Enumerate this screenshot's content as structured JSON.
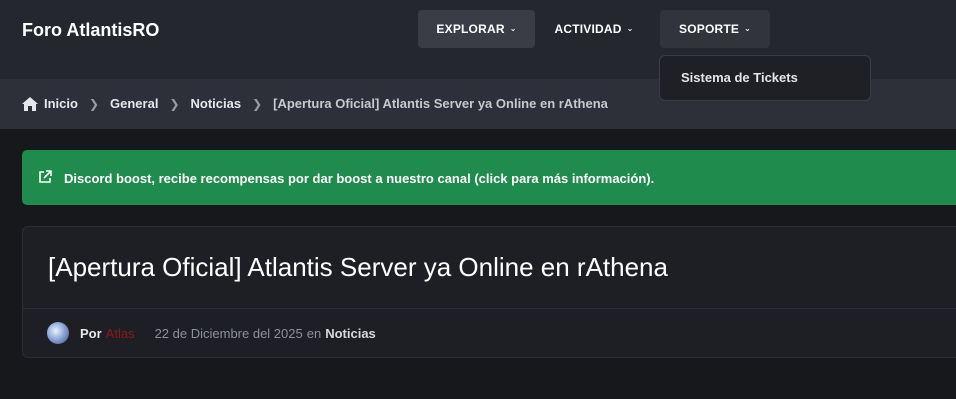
{
  "header": {
    "site_title": "Foro AtlantisRO",
    "nav": [
      {
        "label": "EXPLORAR"
      },
      {
        "label": "ACTIVIDAD"
      },
      {
        "label": "SOPORTE"
      }
    ],
    "dropdown": {
      "items": [
        {
          "label": "Sistema de Tickets"
        }
      ]
    }
  },
  "breadcrumb": {
    "items": [
      "Inicio",
      "General",
      "Noticias",
      "[Apertura Oficial] Atlantis Server ya Online en rAthena"
    ]
  },
  "alert": {
    "text": "Discord boost, recibe recompensas por dar boost a nuestro canal (click para más información).",
    "icon": "external-link-icon",
    "color": "#1f8b4c"
  },
  "article": {
    "title": "[Apertura Oficial] Atlantis Server ya Online en rAthena",
    "by_label": "Por",
    "author": "Atlas",
    "author_color": "#8a1a1a",
    "date": "22 de Diciembre del 2025",
    "in_label": "en",
    "category": "Noticias"
  },
  "colors": {
    "background": "#17181c",
    "header": "#25272e",
    "breadcrumb_bar": "#2d3038"
  }
}
